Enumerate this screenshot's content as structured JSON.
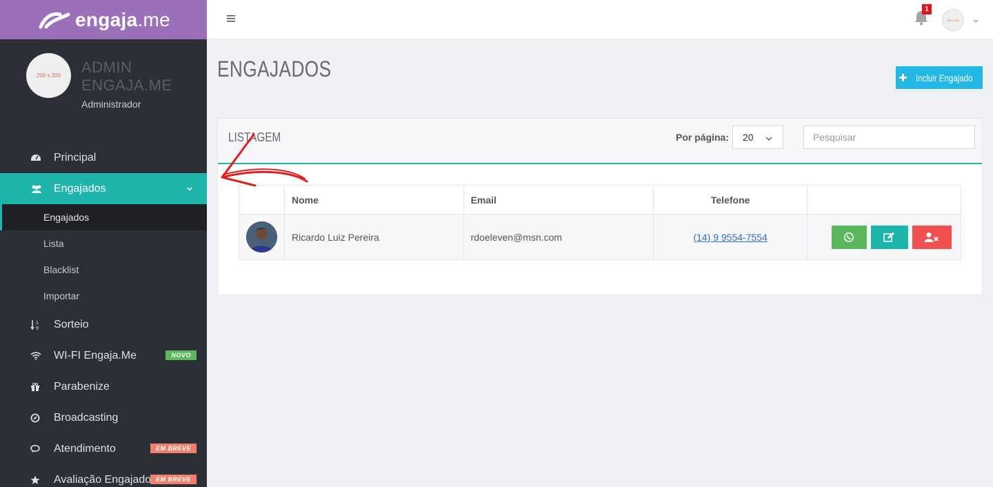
{
  "brand": {
    "name_bold": "engaja",
    "name_light": ".me"
  },
  "profile": {
    "avatar_placeholder": "200 x 200",
    "name": "ADMIN ENGAJA.ME",
    "role": "Administrador"
  },
  "menu": {
    "principal": "Principal",
    "engajados": "Engajados",
    "sub": [
      "Engajados",
      "Lista",
      "Blacklist",
      "Importar"
    ],
    "sorteio": "Sorteio",
    "wifi": "WI-FI Engaja.Me",
    "wifi_badge": "NOVO",
    "parabenize": "Parabenize",
    "broadcasting": "Broadcasting",
    "atendimento": "Atendimento",
    "atendimento_badge": "EM BREVE",
    "avaliacao": "Avaliação Engajados",
    "avaliacao_badge": "EM BREVE"
  },
  "topbar": {
    "notification_count": "1",
    "avatar_placeholder": "200 x 200"
  },
  "page": {
    "title": "ENGAJADOS",
    "include_button": "Incluir Engajado"
  },
  "listing": {
    "title": "LISTAGEM",
    "per_page_label": "Por página:",
    "per_page_value": "20",
    "search_placeholder": "Pesquisar",
    "columns": [
      "",
      "Nome",
      "Email",
      "Telefone",
      ""
    ],
    "rows": [
      {
        "name": "Ricardo Luiz Pereira",
        "email": "rdoeleven@msn.com",
        "phone": "(14) 9 9554-7554"
      }
    ]
  },
  "colors": {
    "sidebar": "#2d2f37",
    "brand": "#9c6fbb",
    "accent": "#1fb5ac",
    "include": "#23b7e5",
    "whatsapp": "#5cb85c",
    "delete": "#f05050"
  }
}
